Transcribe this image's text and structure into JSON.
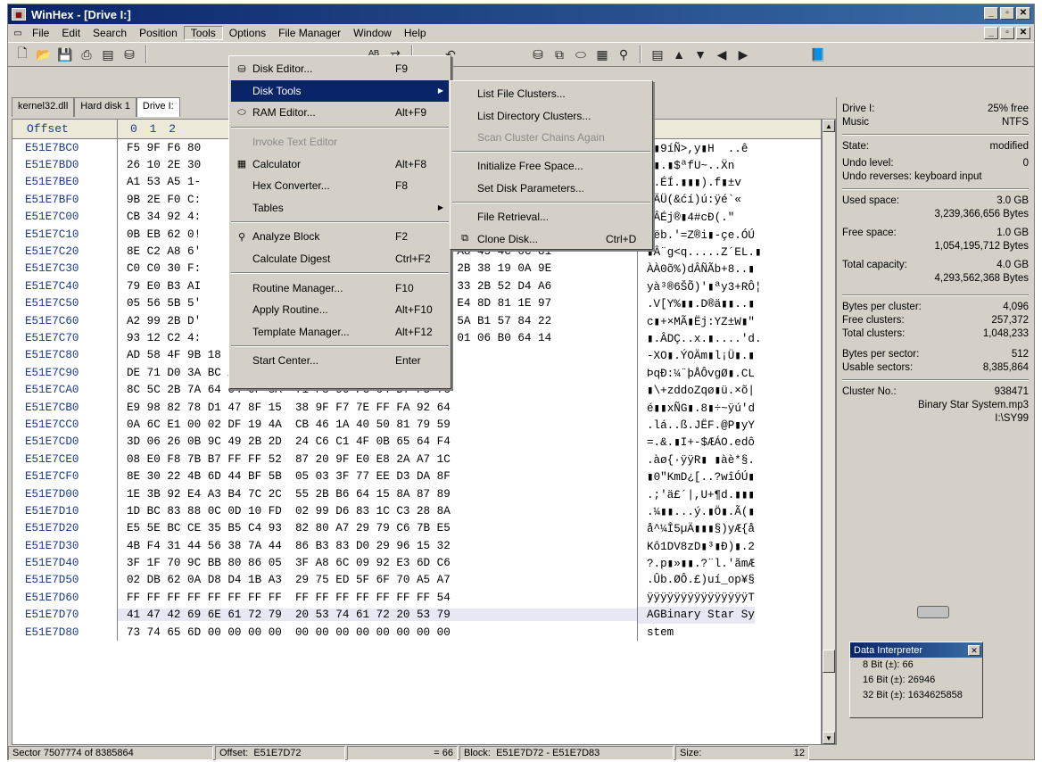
{
  "window": {
    "title": "WinHex - [Drive I:]"
  },
  "menubar": [
    "File",
    "Edit",
    "Search",
    "Position",
    "Tools",
    "Options",
    "File Manager",
    "Window",
    "Help"
  ],
  "tabs": [
    "kernel32.dll",
    "Hard disk 1",
    "Drive I:"
  ],
  "hex_header": {
    "offset": "Offset",
    "columns": "0 1 2"
  },
  "rows": [
    {
      "off": "E51E7BC0",
      "hex": "F5 9F F6 80",
      "txt": "õ▮9íÑ>,y▮H  ..ê"
    },
    {
      "off": "E51E7BD0",
      "hex": "26 10 2E 30",
      "txt": "<▮.▮$ªfU~..Ẍn"
    },
    {
      "off": "E51E7BE0",
      "hex": "A1 53 A5 1-",
      "txt": "▮.ÉÍ.▮▮▮).f▮±v"
    },
    {
      "off": "E51E7BF0",
      "hex": "9B 2E F0 C:",
      "txt": "ßÄÜ(&ćí)ú:ÿé`«"
    },
    {
      "off": "E51E7C00",
      "hex": "CB 34 92 4:",
      "txt": "ÄÂÉj®▮4#cĐ(.\""
    },
    {
      "off": "E51E7C10",
      "hex": "0B EB 62 0!",
      "sub": "A2 A2 12 D3 DA",
      "txt": ".ëb.'=Z®i▮-çe.ÓÚ"
    },
    {
      "off": "E51E7C20",
      "hex": "8E C2 A8 6'",
      "sub": "A8 45 4C 0C 81",
      "txt": "▮Â¨g<q.....Z´EL.▮"
    },
    {
      "off": "E51E7C30",
      "hex": "C0 C0 30 F:",
      "sub": "2B 38 19 0A 9E",
      "txt": "ÀÀ0õ%)dÂÑÃb+8..▮"
    },
    {
      "off": "E51E7C40",
      "hex": "79 E0 B3 AI",
      "sub": "33 2B 52 D4 A6",
      "txt": "yà³®6ŠÕ)'▮ªy3+RÔ¦"
    },
    {
      "off": "E51E7C50",
      "hex": "05 56 5B 5'",
      "sub": "E4 8D 81 1E 97",
      "txt": ".V[Y%▮▮.D®ä▮▮..▮"
    },
    {
      "off": "E51E7C60",
      "hex": "A2 99 2B D'",
      "sub": "5A B1 57 84 22",
      "txt": "c▮+×MÃ▮Ëj:YZ±W▮\""
    },
    {
      "off": "E51E7C70",
      "hex": "93 12 C2 4:",
      "sub": "01 06 B0 64 14",
      "txt": "▮.ÂDÇ..x.▮....'d."
    },
    {
      "off": "E51E7C80",
      "hex": "AD 58 4F 9B 18 DD 30 C4",
      "sub": "6D 93 6C A1 DC 8B 18 9C",
      "txt": "-XO▮.ÝOÄm▮l¡Ü▮.▮"
    },
    {
      "off": "E51E7C90",
      "hex": "DE 71 D0 3A BC A8 FE C5",
      "sub": "D4 76 67 D8 97 10 43 4C",
      "txt": "ÞqĐ:¼¨þÅÔvgØ▮.CL"
    },
    {
      "off": "E51E7CA0",
      "hex": "8C 5C 2B 7A 64 64 6F 5A",
      "sub": "71 F8 96 FC 04 D7 F5 7C",
      "txt": "▮\\+zddoZqø▮ü.×õ|"
    },
    {
      "off": "E51E7CB0",
      "hex": "E9 98 82 78 D1 47 8F 15",
      "sub": "38 9F F7 7E FF FA 92 64",
      "txt": "é▮▮xÑG▮.8▮÷~ÿú'd"
    },
    {
      "off": "E51E7CC0",
      "hex": "0A 6C E1 00 02 DF 19 4A",
      "sub": "CB 46 1A 40 50 81 79 59",
      "txt": ".lá..ß.JËF.@P▮yY"
    },
    {
      "off": "E51E7CD0",
      "hex": "3D 06 26 0B 9C 49 2B 2D",
      "sub": "24 C6 C1 4F 0B 65 64 F4",
      "txt": "=.&.▮I+-$ÆÁO.edô"
    },
    {
      "off": "E51E7CE0",
      "hex": "08 E0 F8 7B B7 FF FF 52",
      "sub": "87 20 9F E0 E8 2A A7 1C",
      "txt": ".àø{·ÿÿR▮ ▮àè*§."
    },
    {
      "off": "E51E7CF0",
      "hex": "8E 30 22 4B 6D 44 BF 5B",
      "sub": "05 03 3F 77 EE D3 DA 8F",
      "txt": "▮0\"KmD¿[..?wîÓÚ▮"
    },
    {
      "off": "E51E7D00",
      "hex": "1E 3B 92 E4 A3 B4 7C 2C",
      "sub": "55 2B B6 64 15 8A 87 89",
      "txt": ".;'ä£´|,U+¶d.▮▮▮"
    },
    {
      "off": "E51E7D10",
      "hex": "1D BC 83 88 0C 0D 10 FD",
      "sub": "02 99 D6 83 1C C3 28 8A",
      "txt": ".¼▮▮...ý.▮Ö▮.Ã(▮"
    },
    {
      "off": "E51E7D20",
      "hex": "E5 5E BC CE 35 B5 C4 93",
      "sub": "82 80 A7 29 79 C6 7B E5",
      "txt": "å^¼Î5µÄ▮▮▮§)yÆ{å"
    },
    {
      "off": "E51E7D30",
      "hex": "4B F4 31 44 56 38 7A 44",
      "sub": "86 B3 83 D0 29 96 15 32",
      "txt": "Kô1DV8zD▮³▮Ð)▮.2"
    },
    {
      "off": "E51E7D40",
      "hex": "3F 1F 70 9C BB 80 86 05",
      "sub": "3F A8 6C 09 92 E3 6D C6",
      "txt": "?.p▮»▮▮.?¨l.'ãmÆ"
    },
    {
      "off": "E51E7D50",
      "hex": "02 DB 62 0A D8 D4 1B A3",
      "sub": "29 75 ED 5F 6F 70 A5 A7",
      "txt": ".Ûb.ØÔ.£)uí_op¥§"
    },
    {
      "off": "E51E7D60",
      "hex": "FF FF FF FF FF FF FF FF",
      "sub": "FF FF FF FF FF FF FF 54",
      "txt": "ÿÿÿÿÿÿÿÿÿÿÿÿÿÿÿT"
    },
    {
      "off": "E51E7D70",
      "hex": "41 47 42 69 6E 61 72 79",
      "sub": "20 53 74 61 72 20 53 79",
      "txt": "AGBinary Star Sy"
    },
    {
      "off": "E51E7D80",
      "hex": "73 74 65 6D 00 00 00 00",
      "sub": "00 00 00 00 00 00 00 00",
      "txt": "stem"
    }
  ],
  "tools_menu": [
    {
      "icon": "disk",
      "label": "Disk Editor...",
      "sc": "F9"
    },
    {
      "icon": "",
      "label": "Disk Tools",
      "sc": "",
      "sub": true,
      "hl": true
    },
    {
      "icon": "ram",
      "label": "RAM Editor...",
      "sc": "Alt+F9"
    },
    {
      "sep": true
    },
    {
      "icon": "",
      "label": "Invoke Text Editor",
      "sc": "",
      "dis": true
    },
    {
      "icon": "calc",
      "label": "Calculator",
      "sc": "Alt+F8"
    },
    {
      "icon": "",
      "label": "Hex Converter...",
      "sc": "F8"
    },
    {
      "icon": "",
      "label": "Tables",
      "sc": "",
      "sub": true
    },
    {
      "sep": true
    },
    {
      "icon": "search",
      "label": "Analyze Block",
      "sc": "F2"
    },
    {
      "icon": "",
      "label": "Calculate Digest",
      "sc": "Ctrl+F2"
    },
    {
      "sep": true
    },
    {
      "icon": "",
      "label": "Routine Manager...",
      "sc": "F10"
    },
    {
      "icon": "",
      "label": "Apply Routine...",
      "sc": "Alt+F10"
    },
    {
      "icon": "",
      "label": "Template Manager...",
      "sc": "Alt+F12"
    },
    {
      "sep": true
    },
    {
      "icon": "",
      "label": "Start Center...",
      "sc": "Enter"
    }
  ],
  "disk_tools_submenu": [
    {
      "label": "List File Clusters..."
    },
    {
      "label": "List Directory Clusters..."
    },
    {
      "label": "Scan Cluster Chains Again",
      "dis": true
    },
    {
      "sep": true
    },
    {
      "label": "Initialize Free Space..."
    },
    {
      "label": "Set Disk Parameters..."
    },
    {
      "sep": true
    },
    {
      "label": "File Retrieval..."
    },
    {
      "label": "Clone Disk...",
      "sc": "Ctrl+D",
      "icon": "clone"
    }
  ],
  "info": {
    "drive": "Drive I:",
    "free_pct": "25% free",
    "label": "Music",
    "fs": "NTFS",
    "state_k": "State:",
    "state_v": "modified",
    "undo_k": "Undo level:",
    "undo_v": "0",
    "undo_rev": "Undo reverses: keyboard input",
    "used_k": "Used space:",
    "used_gb": "3.0 GB",
    "used_b": "3,239,366,656 Bytes",
    "free_k": "Free space:",
    "free_gb": "1.0 GB",
    "free_b": "1,054,195,712 Bytes",
    "total_k": "Total capacity:",
    "total_gb": "4.0 GB",
    "total_b": "4,293,562,368 Bytes",
    "bpc_k": "Bytes per cluster:",
    "bpc_v": "4,096",
    "fc_k": "Free clusters:",
    "fc_v": "257,372",
    "tc_k": "Total clusters:",
    "tc_v": "1,048,233",
    "bps_k": "Bytes per sector:",
    "bps_v": "512",
    "us_k": "Usable sectors:",
    "us_v": "8,385,864",
    "cn_k": "Cluster No.:",
    "cn_v": "938471",
    "file": "Binary Star System.mp3",
    "path": "I:\\SY99"
  },
  "interpreter": {
    "title": "Data Interpreter",
    "b8": "8 Bit (±): 66",
    "b16": "16 Bit (±): 26946",
    "b32": "32 Bit (±): 1634625858"
  },
  "status": {
    "sector": "Sector 7507774 of 8385864",
    "offset_k": "Offset:",
    "offset_v": "E51E7D72",
    "val": "= 66",
    "block_k": "Block:",
    "block_v": "E51E7D72 - E51E7D83",
    "size_k": "Size:",
    "size_v": "12"
  }
}
